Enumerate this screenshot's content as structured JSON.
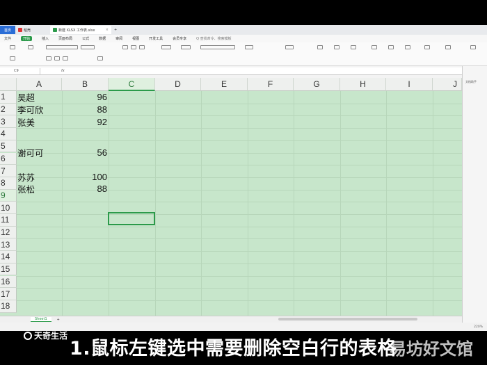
{
  "tabs": {
    "home": "首页",
    "tab1": "稻壳",
    "tab2": "新建 XLSX 工作表.xlsx",
    "add": "+"
  },
  "menu": [
    "文件",
    "开始",
    "插入",
    "页面布局",
    "公式",
    "数据",
    "审阅",
    "视图",
    "开发工具",
    "会员专享"
  ],
  "menu_active": "开始",
  "search_placeholder": "Q 查找命令、搜索模板",
  "formula": {
    "cell_ref": "C9",
    "fx": "fx",
    "value": ""
  },
  "columns": [
    "A",
    "B",
    "C",
    "D",
    "E",
    "F",
    "G",
    "H",
    "I",
    "J"
  ],
  "selected_column": "C",
  "rows": [
    "1",
    "2",
    "3",
    "4",
    "5",
    "6",
    "7",
    "8",
    "9",
    "10",
    "11",
    "12",
    "13",
    "14",
    "15",
    "16",
    "17",
    "18"
  ],
  "selected_row": "9",
  "data": [
    {
      "row": "1",
      "name": "吴超",
      "value": "96"
    },
    {
      "row": "2",
      "name": "李可欣",
      "value": "88"
    },
    {
      "row": "3",
      "name": "张美",
      "value": "92"
    },
    {
      "row": "4",
      "name": "",
      "value": ""
    },
    {
      "row": "5",
      "name": "谢可可",
      "value": "56"
    },
    {
      "row": "6",
      "name": "",
      "value": ""
    },
    {
      "row": "7",
      "name": "苏苏",
      "value": "100"
    },
    {
      "row": "8",
      "name": "张松",
      "value": "88"
    }
  ],
  "sheet_tab": "Sheet1",
  "sheet_add": "+",
  "zoom": "220%",
  "pane_title": "文档助手",
  "watermark": "天奇生活",
  "subtitle": "1.鼠标左键选中需要删除空白行的表格",
  "site_watermark": "易坊好文馆",
  "colors": {
    "selection_fill": "#c7e6cb",
    "accent": "#2b9a4a",
    "home_tab": "#2b6dd6"
  }
}
